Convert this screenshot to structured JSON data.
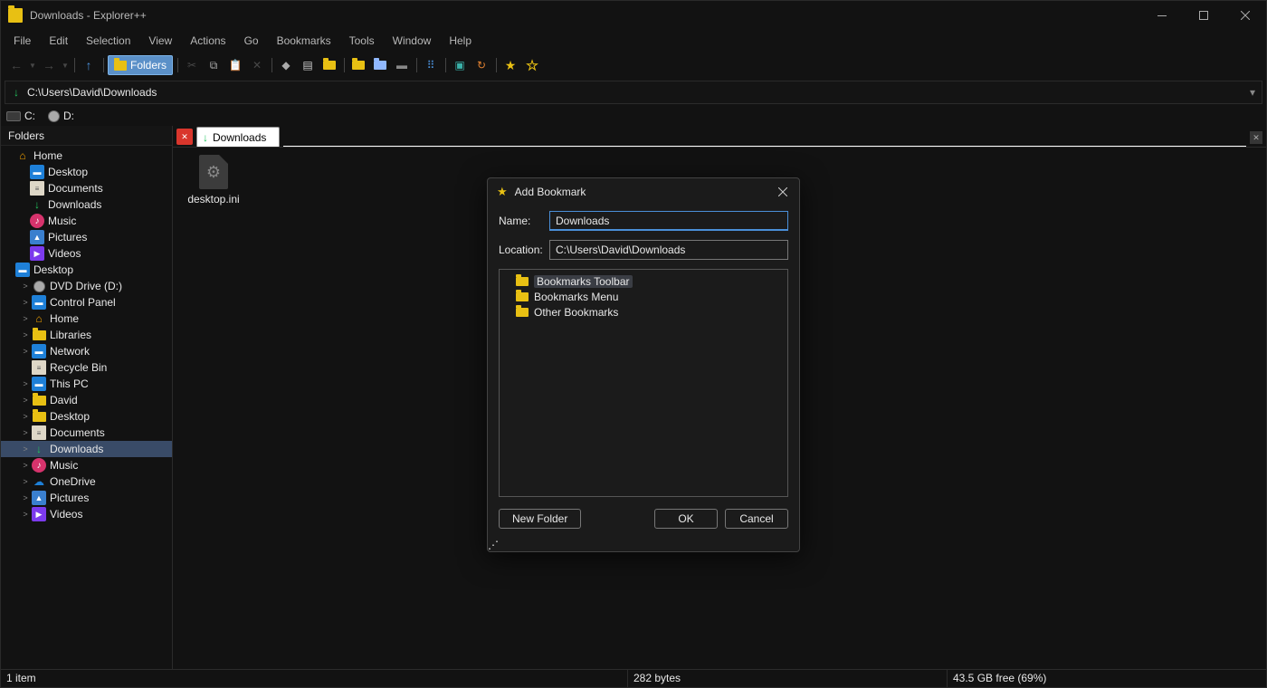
{
  "window": {
    "title": "Downloads - Explorer++"
  },
  "menubar": [
    "File",
    "Edit",
    "Selection",
    "View",
    "Actions",
    "Go",
    "Bookmarks",
    "Tools",
    "Window",
    "Help"
  ],
  "toolbar": {
    "folders_label": "Folders"
  },
  "addressbar": {
    "path": "C:\\Users\\David\\Downloads"
  },
  "drives": [
    {
      "label": "C:",
      "type": "hdd"
    },
    {
      "label": "D:",
      "type": "dvd"
    }
  ],
  "sidebar": {
    "header": "Folders",
    "tree": [
      {
        "label": "Home",
        "icon": "home",
        "indent": 0,
        "exp": ""
      },
      {
        "label": "Desktop",
        "icon": "pc",
        "indent": 1,
        "exp": ""
      },
      {
        "label": "Documents",
        "icon": "doc",
        "indent": 1,
        "exp": ""
      },
      {
        "label": "Downloads",
        "icon": "dl",
        "indent": 1,
        "exp": ""
      },
      {
        "label": "Music",
        "icon": "music",
        "indent": 1,
        "exp": ""
      },
      {
        "label": "Pictures",
        "icon": "pic",
        "indent": 1,
        "exp": ""
      },
      {
        "label": "Videos",
        "icon": "vid",
        "indent": 1,
        "exp": ""
      },
      {
        "label": "Desktop",
        "icon": "pc",
        "indent": 0,
        "exp": ""
      },
      {
        "label": "DVD Drive (D:)",
        "icon": "dvd",
        "indent": 2,
        "exp": ">"
      },
      {
        "label": "Control Panel",
        "icon": "pc",
        "indent": 2,
        "exp": ">"
      },
      {
        "label": "Home",
        "icon": "home",
        "indent": 2,
        "exp": ">"
      },
      {
        "label": "Libraries",
        "icon": "folder",
        "indent": 2,
        "exp": ">"
      },
      {
        "label": "Network",
        "icon": "pc",
        "indent": 2,
        "exp": ">"
      },
      {
        "label": "Recycle Bin",
        "icon": "doc",
        "indent": 2,
        "exp": ""
      },
      {
        "label": "This PC",
        "icon": "pc",
        "indent": 2,
        "exp": ">"
      },
      {
        "label": "David",
        "icon": "folder",
        "indent": 2,
        "exp": ">"
      },
      {
        "label": "Desktop",
        "icon": "folder",
        "indent": 2,
        "exp": ">"
      },
      {
        "label": "Documents",
        "icon": "doc",
        "indent": 2,
        "exp": ">"
      },
      {
        "label": "Downloads",
        "icon": "dl",
        "indent": 2,
        "exp": ">",
        "sel": true
      },
      {
        "label": "Music",
        "icon": "music",
        "indent": 2,
        "exp": ">"
      },
      {
        "label": "OneDrive",
        "icon": "cloud",
        "indent": 2,
        "exp": ">"
      },
      {
        "label": "Pictures",
        "icon": "pic",
        "indent": 2,
        "exp": ">"
      },
      {
        "label": "Videos",
        "icon": "vid",
        "indent": 2,
        "exp": ">"
      }
    ]
  },
  "tabs": {
    "active": "Downloads"
  },
  "files": [
    {
      "name": "desktop.ini"
    }
  ],
  "dialog": {
    "title": "Add Bookmark",
    "name_label": "Name:",
    "location_label": "Location:",
    "name_value": "Downloads",
    "location_value": "C:\\Users\\David\\Downloads",
    "tree": [
      {
        "label": "Bookmarks Toolbar",
        "sel": true
      },
      {
        "label": "Bookmarks Menu"
      },
      {
        "label": "Other Bookmarks"
      }
    ],
    "new_folder": "New Folder",
    "ok": "OK",
    "cancel": "Cancel"
  },
  "status": {
    "items": "1 item",
    "size": "282 bytes",
    "free": "43.5 GB free (69%)"
  }
}
